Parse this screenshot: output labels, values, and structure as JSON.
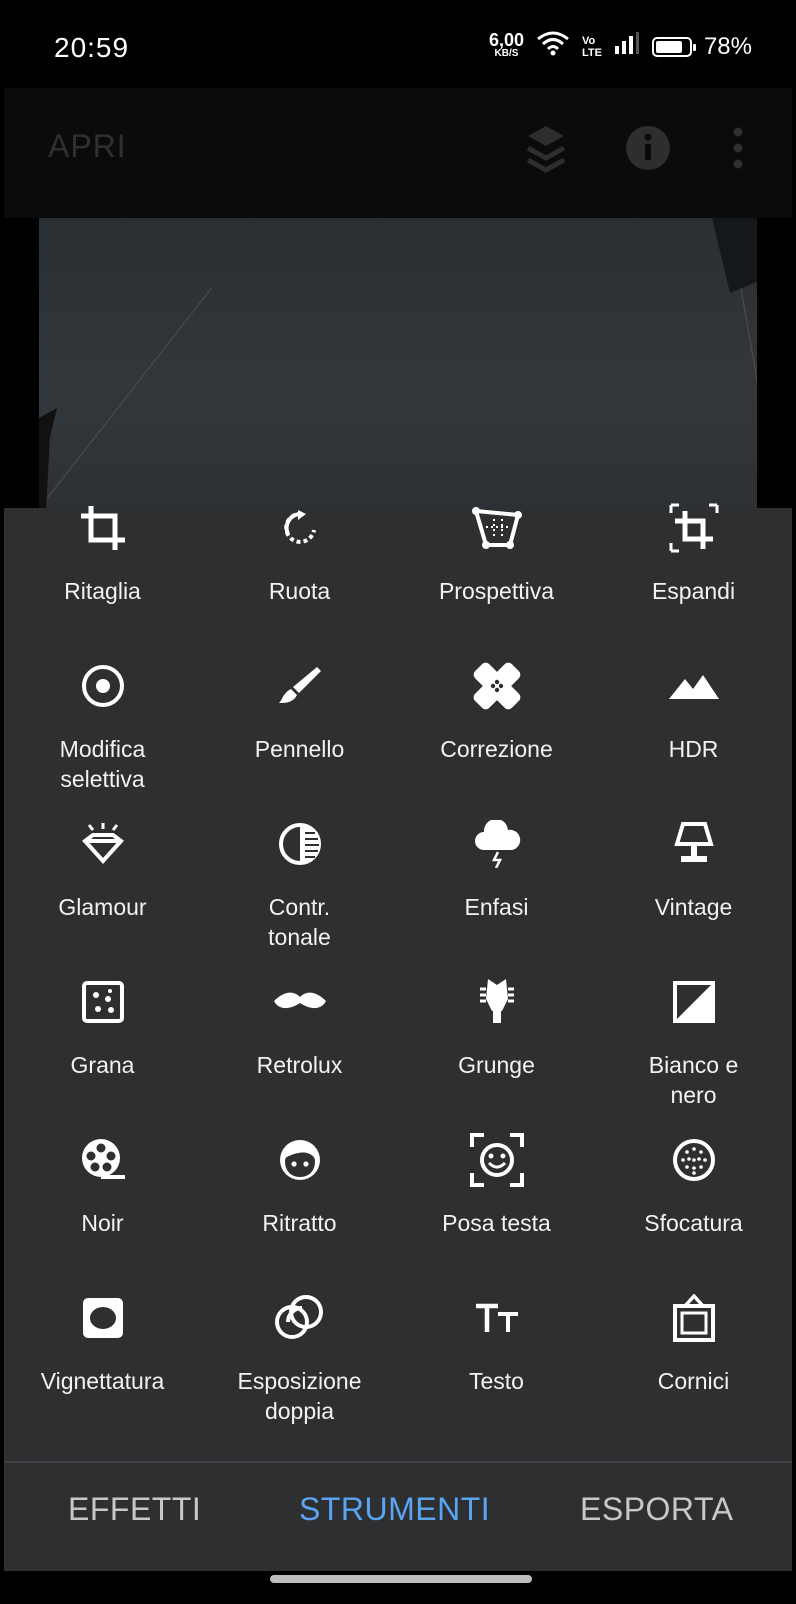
{
  "status_bar": {
    "time": "20:59",
    "speed_value": "6,00",
    "speed_unit": "KB/S",
    "volte_top": "Vo",
    "volte_bottom": "LTE",
    "battery": "78%"
  },
  "app_bar": {
    "title": "APRI",
    "icons": [
      "layers-sync-icon",
      "info-icon",
      "more-vert-icon"
    ]
  },
  "tools": [
    {
      "label": "Ritaglia",
      "icon": "crop-icon"
    },
    {
      "label": "Ruota",
      "icon": "rotate-icon"
    },
    {
      "label": "Prospettiva",
      "icon": "perspective-icon"
    },
    {
      "label": "Espandi",
      "icon": "expand-icon"
    },
    {
      "label": "Modifica\nselettiva",
      "icon": "selective-icon"
    },
    {
      "label": "Pennello",
      "icon": "brush-icon"
    },
    {
      "label": "Correzione",
      "icon": "healing-icon"
    },
    {
      "label": "HDR",
      "icon": "hdr-mountain-icon"
    },
    {
      "label": "Glamour",
      "icon": "glamour-diamond-icon"
    },
    {
      "label": "Contr.\ntonale",
      "icon": "tonal-contrast-icon"
    },
    {
      "label": "Enfasi",
      "icon": "drama-cloud-icon"
    },
    {
      "label": "Vintage",
      "icon": "vintage-lamp-icon"
    },
    {
      "label": "Grana",
      "icon": "grain-icon"
    },
    {
      "label": "Retrolux",
      "icon": "mustache-icon"
    },
    {
      "label": "Grunge",
      "icon": "grunge-guitar-icon"
    },
    {
      "label": "Bianco e\nnero",
      "icon": "black-white-icon"
    },
    {
      "label": "Noir",
      "icon": "film-reel-icon"
    },
    {
      "label": "Ritratto",
      "icon": "face-icon"
    },
    {
      "label": "Posa testa",
      "icon": "head-pose-icon"
    },
    {
      "label": "Sfocatura",
      "icon": "lens-blur-icon"
    },
    {
      "label": "Vignettatura",
      "icon": "vignette-icon"
    },
    {
      "label": "Esposizione\ndoppia",
      "icon": "double-exposure-icon"
    },
    {
      "label": "Testo",
      "icon": "text-icon"
    },
    {
      "label": "Cornici",
      "icon": "frames-icon"
    }
  ],
  "tabs": [
    {
      "label": "EFFETTI",
      "active": false
    },
    {
      "label": "STRUMENTI",
      "active": true
    },
    {
      "label": "ESPORTA",
      "active": false
    }
  ],
  "colors": {
    "panel": "#2e2f31",
    "active_tab": "#5aa4f0",
    "inactive_tab": "#c8c8c8"
  }
}
